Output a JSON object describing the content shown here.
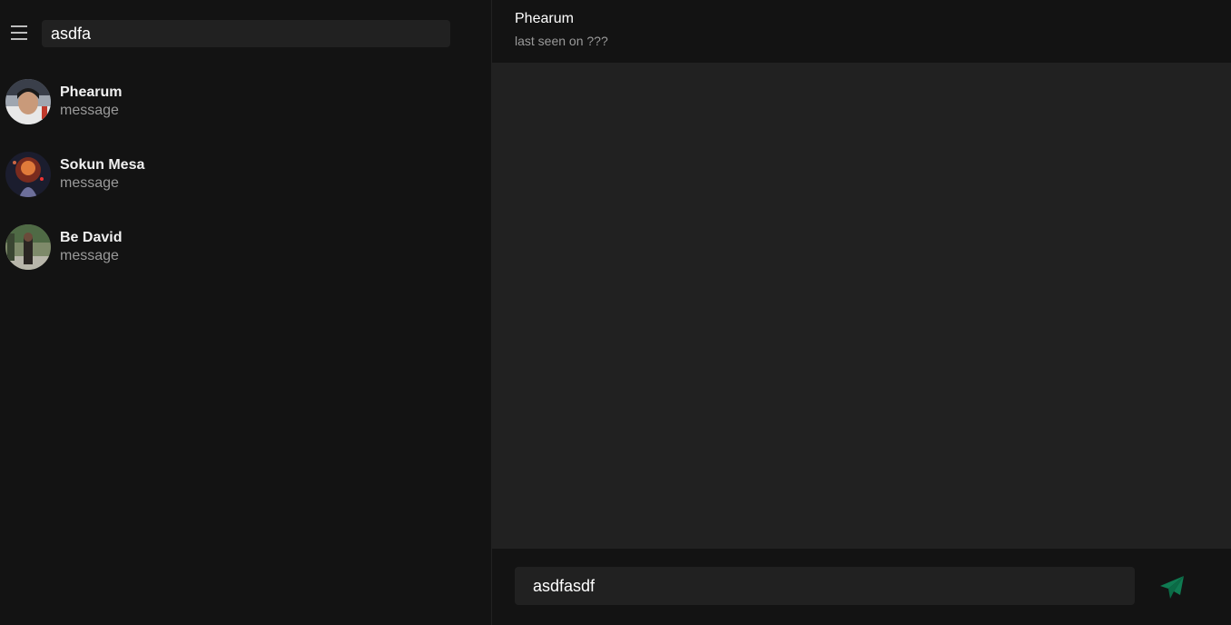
{
  "sidebar": {
    "menu_icon": "hamburger-menu-icon",
    "search": {
      "value": "asdfa",
      "placeholder": ""
    },
    "chats": [
      {
        "name": "Phearum",
        "preview": "message"
      },
      {
        "name": "Sokun Mesa",
        "preview": "message"
      },
      {
        "name": "Be David",
        "preview": "message"
      }
    ]
  },
  "conversation": {
    "contact_name": "Phearum",
    "status": "last seen on ???",
    "composer": {
      "value": "asdfasdf",
      "placeholder": ""
    },
    "send_icon": "paper-plane-icon"
  },
  "colors": {
    "background": "#131313",
    "panel": "#212121",
    "accent": "#0f7b52",
    "muted_text": "#9a9a9a"
  }
}
